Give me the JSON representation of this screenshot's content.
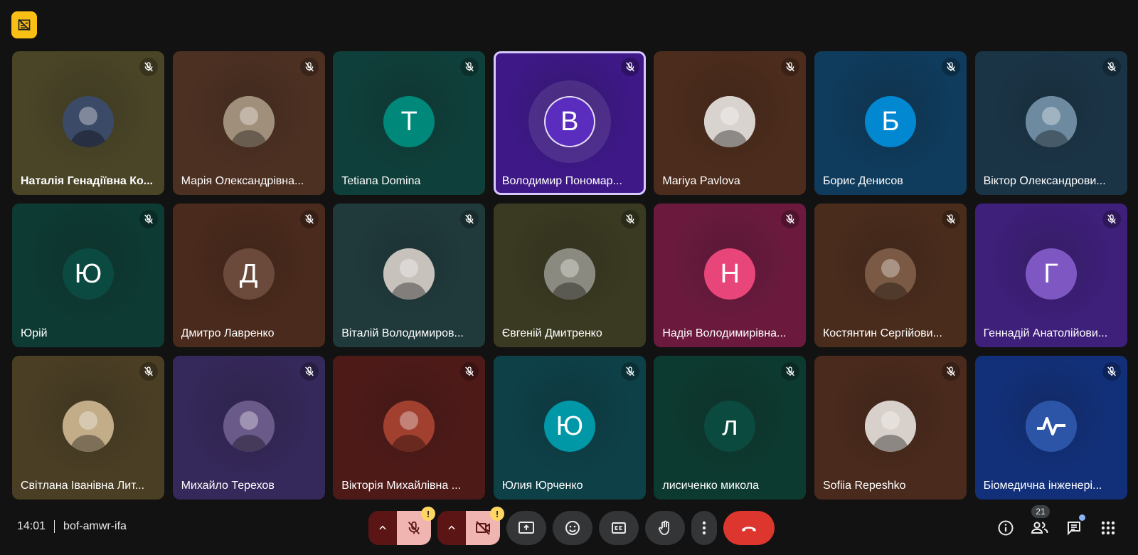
{
  "meeting": {
    "time": "14:01",
    "code": "bof-amwr-ifa",
    "participant_count": "21"
  },
  "colors": {
    "background": "#121212",
    "hangup": "#dc362e",
    "warning": "#fdd663",
    "active_speaker_border": "#d7c8ff",
    "recording_badge": "#f9bf15"
  },
  "participants": [
    {
      "name": "Наталія Генадіївна Ко...",
      "initial": "",
      "avatar_type": "photo",
      "tile_color": "#4a4527",
      "avatar_color": "#3b4a66",
      "bold": true
    },
    {
      "name": "Марія Олександрівна...",
      "initial": "",
      "avatar_type": "photo",
      "tile_color": "#4c3022",
      "avatar_color": "#a08f7a",
      "bold": false
    },
    {
      "name": "Tetiana Domina",
      "initial": "T",
      "avatar_type": "letter",
      "tile_color": "#0f3f3a",
      "avatar_color": "#00897b",
      "bold": false
    },
    {
      "name": "Володимир Пономар...",
      "initial": "B",
      "avatar_type": "letter",
      "tile_color": "#3d1886",
      "avatar_color": "#5b2dbf",
      "bold": false,
      "active": true
    },
    {
      "name": "Mariya Pavlova",
      "initial": "",
      "avatar_type": "photo",
      "tile_color": "#4c2c1c",
      "avatar_color": "#d9d3cf",
      "bold": false
    },
    {
      "name": "Борис Денисов",
      "initial": "Б",
      "avatar_type": "letter",
      "tile_color": "#0f3b5c",
      "avatar_color": "#0288d1",
      "bold": false
    },
    {
      "name": "Віктор Олександрови...",
      "initial": "",
      "avatar_type": "photo",
      "tile_color": "#1a3446",
      "avatar_color": "#6d8aa0",
      "bold": false
    },
    {
      "name": "Юрій",
      "initial": "Ю",
      "avatar_type": "letter",
      "tile_color": "#0d3a33",
      "avatar_color": "#0b4a40",
      "bold": false
    },
    {
      "name": "Дмитро Лавренко",
      "initial": "Д",
      "avatar_type": "letter",
      "tile_color": "#4a2a1c",
      "avatar_color": "#6b4a3c",
      "bold": false
    },
    {
      "name": "Віталій Володимиров...",
      "initial": "",
      "avatar_type": "photo",
      "tile_color": "#203a3c",
      "avatar_color": "#c8c2bd",
      "bold": false
    },
    {
      "name": "Євгеній Дмитренко",
      "initial": "",
      "avatar_type": "photo",
      "tile_color": "#3a3a22",
      "avatar_color": "#8a8a80",
      "bold": false
    },
    {
      "name": "Надія Володимирівна...",
      "initial": "Н",
      "avatar_type": "letter",
      "tile_color": "#6b1a3e",
      "avatar_color": "#e8457a",
      "bold": false
    },
    {
      "name": "Костянтин Сергійови...",
      "initial": "",
      "avatar_type": "photo",
      "tile_color": "#4a2c1c",
      "avatar_color": "#7a5a44",
      "bold": false
    },
    {
      "name": "Геннадій Анатолійови...",
      "initial": "Г",
      "avatar_type": "letter",
      "tile_color": "#3e1f7a",
      "avatar_color": "#7e57c2",
      "bold": false
    },
    {
      "name": "Світлана Іванівна Лит...",
      "initial": "",
      "avatar_type": "photo",
      "tile_color": "#4a3e24",
      "avatar_color": "#c2ad88",
      "bold": false
    },
    {
      "name": "Михайло Терехов",
      "initial": "",
      "avatar_type": "photo",
      "tile_color": "#35285a",
      "avatar_color": "#6a5a8a",
      "bold": false
    },
    {
      "name": "Вікторія Михайлівна ...",
      "initial": "",
      "avatar_type": "photo",
      "tile_color": "#4e1a18",
      "avatar_color": "#a24030",
      "bold": false
    },
    {
      "name": "Юлия Юрченко",
      "initial": "Ю",
      "avatar_type": "letter",
      "tile_color": "#0e4048",
      "avatar_color": "#0097a7",
      "bold": false
    },
    {
      "name": "лисиченко микола",
      "initial": "л",
      "avatar_type": "letter",
      "tile_color": "#0d3a30",
      "avatar_color": "#0b4a3e",
      "bold": false
    },
    {
      "name": "Sofiia Repeshko",
      "initial": "",
      "avatar_type": "photo",
      "tile_color": "#4a2a1c",
      "avatar_color": "#d8d0ca",
      "bold": false
    },
    {
      "name": "Біомедична інженері...",
      "initial": "",
      "avatar_type": "logo",
      "tile_color": "#12307a",
      "avatar_color": "#2c55a8",
      "bold": false
    }
  ]
}
